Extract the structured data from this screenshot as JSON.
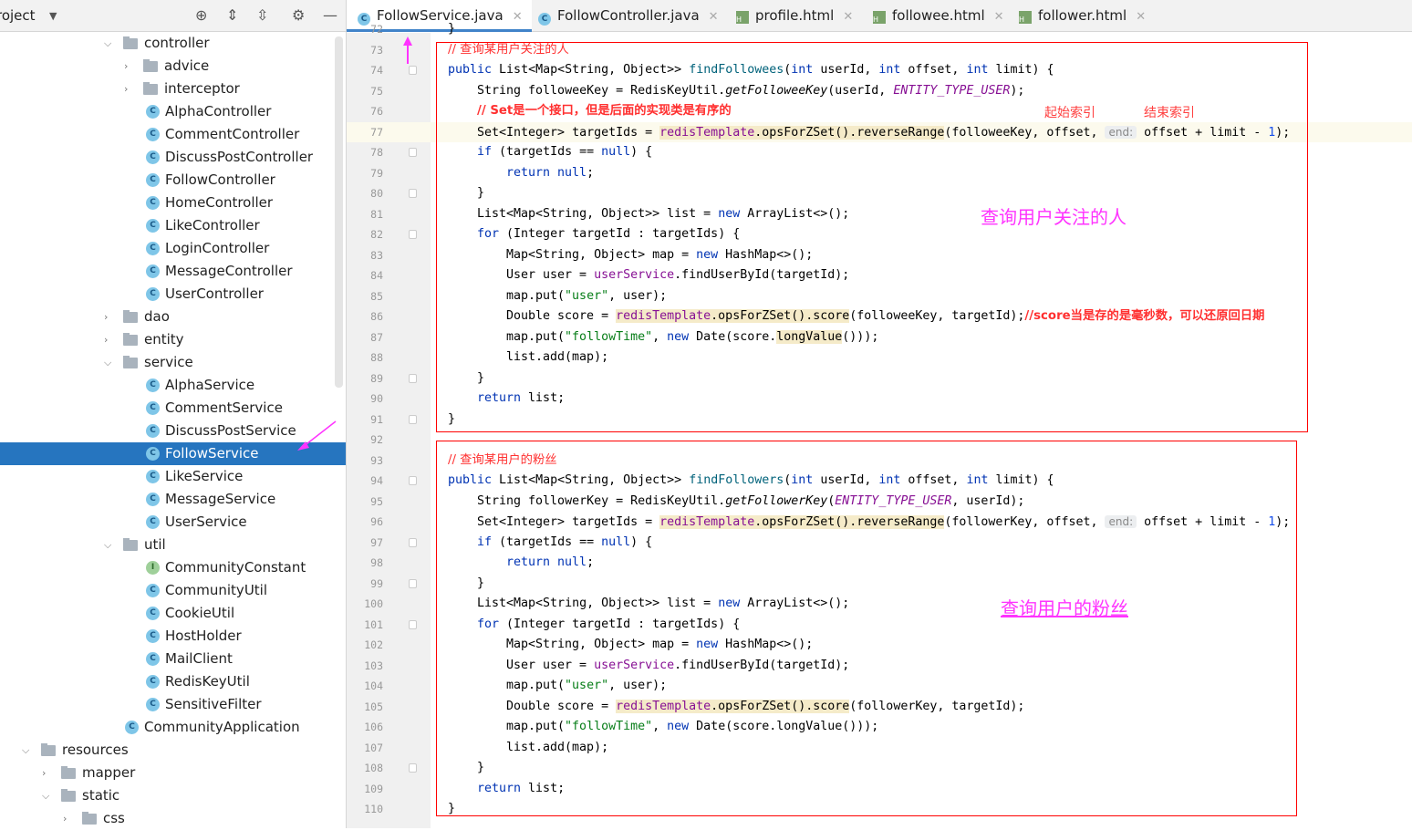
{
  "sidebar": {
    "title": "roject",
    "tree": [
      {
        "label": "controller",
        "type": "folder",
        "depth": 1,
        "expanded": true
      },
      {
        "label": "advice",
        "type": "folder",
        "depth": 2,
        "expanded": false
      },
      {
        "label": "interceptor",
        "type": "folder",
        "depth": 2,
        "expanded": false
      },
      {
        "label": "AlphaController",
        "type": "class",
        "depth": 2
      },
      {
        "label": "CommentController",
        "type": "class",
        "depth": 2
      },
      {
        "label": "DiscussPostController",
        "type": "class",
        "depth": 2
      },
      {
        "label": "FollowController",
        "type": "class",
        "depth": 2
      },
      {
        "label": "HomeController",
        "type": "class",
        "depth": 2
      },
      {
        "label": "LikeController",
        "type": "class",
        "depth": 2
      },
      {
        "label": "LoginController",
        "type": "class",
        "depth": 2
      },
      {
        "label": "MessageController",
        "type": "class",
        "depth": 2
      },
      {
        "label": "UserController",
        "type": "class",
        "depth": 2
      },
      {
        "label": "dao",
        "type": "folder",
        "depth": 1,
        "expanded": false
      },
      {
        "label": "entity",
        "type": "folder",
        "depth": 1,
        "expanded": false
      },
      {
        "label": "service",
        "type": "folder",
        "depth": 1,
        "expanded": true
      },
      {
        "label": "AlphaService",
        "type": "class",
        "depth": 2
      },
      {
        "label": "CommentService",
        "type": "class",
        "depth": 2
      },
      {
        "label": "DiscussPostService",
        "type": "class",
        "depth": 2
      },
      {
        "label": "FollowService",
        "type": "class",
        "depth": 2,
        "selected": true
      },
      {
        "label": "LikeService",
        "type": "class",
        "depth": 2
      },
      {
        "label": "MessageService",
        "type": "class",
        "depth": 2
      },
      {
        "label": "UserService",
        "type": "class",
        "depth": 2
      },
      {
        "label": "util",
        "type": "folder",
        "depth": 1,
        "expanded": true
      },
      {
        "label": "CommunityConstant",
        "type": "interface",
        "depth": 2
      },
      {
        "label": "CommunityUtil",
        "type": "class",
        "depth": 2
      },
      {
        "label": "CookieUtil",
        "type": "class",
        "depth": 2
      },
      {
        "label": "HostHolder",
        "type": "class",
        "depth": 2
      },
      {
        "label": "MailClient",
        "type": "class",
        "depth": 2
      },
      {
        "label": "RedisKeyUtil",
        "type": "class",
        "depth": 2
      },
      {
        "label": "SensitiveFilter",
        "type": "class",
        "depth": 2
      },
      {
        "label": "CommunityApplication",
        "type": "class",
        "depth": 1
      },
      {
        "label": "resources",
        "type": "folder",
        "depth": -2,
        "expanded": true
      },
      {
        "label": "mapper",
        "type": "folder",
        "depth": -1,
        "expanded": false
      },
      {
        "label": "static",
        "type": "folder",
        "depth": -1,
        "expanded": true
      },
      {
        "label": "css",
        "type": "folder",
        "depth": 0,
        "expanded": false
      }
    ]
  },
  "tabs": [
    {
      "label": "FollowService.java",
      "icon": "java-class",
      "active": true
    },
    {
      "label": "FollowController.java",
      "icon": "java-class"
    },
    {
      "label": "profile.html",
      "icon": "html-file"
    },
    {
      "label": "followee.html",
      "icon": "html-file"
    },
    {
      "label": "follower.html",
      "icon": "html-file"
    }
  ],
  "code": [
    {
      "n": "72",
      "seg": [
        [
          "}",
          ""
        ]
      ]
    },
    {
      "n": "73",
      "seg": [
        [
          "// 查询某用户关注的人",
          "c"
        ]
      ]
    },
    {
      "n": "74",
      "fold": true,
      "seg": [
        [
          "public ",
          "k"
        ],
        [
          "List<Map<String, Object>> ",
          ""
        ],
        [
          "findFollowees",
          "d"
        ],
        [
          "(",
          ""
        ],
        [
          "int ",
          "k"
        ],
        [
          "userId, ",
          ""
        ],
        [
          "int ",
          "k"
        ],
        [
          "offset, ",
          ""
        ],
        [
          "int ",
          "k"
        ],
        [
          "limit) {",
          ""
        ]
      ]
    },
    {
      "n": "75",
      "ind": 1,
      "seg": [
        [
          "String followeeKey = RedisKeyUtil.",
          ""
        ],
        [
          "getFolloweeKey",
          "i"
        ],
        [
          "(userId, ",
          ""
        ],
        [
          "ENTITY_TYPE_USER",
          "fi"
        ],
        [
          ");",
          ""
        ]
      ]
    },
    {
      "n": "76",
      "ind": 1,
      "seg": [
        [
          "// Set是一个接口，但是后面的实现类是有序的",
          "cb"
        ]
      ]
    },
    {
      "n": "77",
      "ind": 1,
      "cur": true,
      "seg": [
        [
          "Set<Integer> targetIds = ",
          ""
        ],
        [
          "redisTemplate",
          "f hl"
        ],
        [
          ".opsForZSet().reverseRange",
          "hl"
        ],
        [
          "(followeeKey, offset, ",
          ""
        ],
        [
          "end:",
          "hint"
        ],
        [
          " offset + limit - ",
          ""
        ],
        [
          "1",
          "n"
        ],
        [
          ");",
          ""
        ]
      ]
    },
    {
      "n": "78",
      "ind": 1,
      "fold": true,
      "seg": [
        [
          "if ",
          "k"
        ],
        [
          "(targetIds == ",
          ""
        ],
        [
          "null",
          "k"
        ],
        [
          ") {",
          ""
        ]
      ]
    },
    {
      "n": "79",
      "ind": 2,
      "seg": [
        [
          "return null",
          "k"
        ],
        [
          ";",
          ""
        ]
      ]
    },
    {
      "n": "80",
      "ind": 1,
      "fold": true,
      "seg": [
        [
          "}",
          ""
        ]
      ]
    },
    {
      "n": "81",
      "ind": 1,
      "seg": [
        [
          "List<Map<String, Object>> list = ",
          ""
        ],
        [
          "new ",
          "k"
        ],
        [
          "ArrayList<>();",
          ""
        ]
      ]
    },
    {
      "n": "82",
      "ind": 1,
      "fold": true,
      "seg": [
        [
          "for ",
          "k"
        ],
        [
          "(Integer targetId : targetIds) {",
          ""
        ]
      ]
    },
    {
      "n": "83",
      "ind": 2,
      "seg": [
        [
          "Map<String, Object> map = ",
          ""
        ],
        [
          "new ",
          "k"
        ],
        [
          "HashMap<>();",
          ""
        ]
      ]
    },
    {
      "n": "84",
      "ind": 2,
      "seg": [
        [
          "User user = ",
          ""
        ],
        [
          "userService",
          "f"
        ],
        [
          ".findUserById(targetId);",
          ""
        ]
      ]
    },
    {
      "n": "85",
      "ind": 2,
      "seg": [
        [
          "map.put(",
          ""
        ],
        [
          "\"user\"",
          "s"
        ],
        [
          ", user);",
          ""
        ]
      ]
    },
    {
      "n": "86",
      "ind": 2,
      "seg": [
        [
          "Double score = ",
          ""
        ],
        [
          "redisTemplate",
          "f hl"
        ],
        [
          ".opsForZSet().score",
          "hl"
        ],
        [
          "(followeeKey, targetId);",
          ""
        ],
        [
          "//score当是存的是毫秒数，可以还原回日期",
          "cb"
        ]
      ]
    },
    {
      "n": "87",
      "ind": 2,
      "seg": [
        [
          "map.put(",
          ""
        ],
        [
          "\"followTime\"",
          "s"
        ],
        [
          ", ",
          ""
        ],
        [
          "new ",
          "k"
        ],
        [
          "Date(score.",
          ""
        ],
        [
          "longValue",
          "hl"
        ],
        [
          "()));",
          ""
        ]
      ]
    },
    {
      "n": "88",
      "ind": 2,
      "seg": [
        [
          "list.add(map);",
          ""
        ]
      ]
    },
    {
      "n": "89",
      "ind": 1,
      "fold": true,
      "seg": [
        [
          "}",
          ""
        ]
      ]
    },
    {
      "n": "90",
      "ind": 1,
      "seg": [
        [
          "return ",
          "k"
        ],
        [
          "list;",
          ""
        ]
      ]
    },
    {
      "n": "91",
      "fold": true,
      "seg": [
        [
          "}",
          ""
        ]
      ]
    },
    {
      "n": "92",
      "seg": []
    },
    {
      "n": "93",
      "seg": [
        [
          "// 查询某用户的粉丝",
          "c"
        ]
      ]
    },
    {
      "n": "94",
      "fold": true,
      "seg": [
        [
          "public ",
          "k"
        ],
        [
          "List<Map<String, Object>> ",
          ""
        ],
        [
          "findFollowers",
          "d"
        ],
        [
          "(",
          ""
        ],
        [
          "int ",
          "k"
        ],
        [
          "userId, ",
          ""
        ],
        [
          "int ",
          "k"
        ],
        [
          "offset, ",
          ""
        ],
        [
          "int ",
          "k"
        ],
        [
          "limit) {",
          ""
        ]
      ]
    },
    {
      "n": "95",
      "ind": 1,
      "seg": [
        [
          "String followerKey = RedisKeyUtil.",
          ""
        ],
        [
          "getFollowerKey",
          "i"
        ],
        [
          "(",
          ""
        ],
        [
          "ENTITY_TYPE_USER",
          "fi"
        ],
        [
          ", userId);",
          ""
        ]
      ]
    },
    {
      "n": "96",
      "ind": 1,
      "seg": [
        [
          "Set<Integer> targetIds = ",
          ""
        ],
        [
          "redisTemplate",
          "f hl"
        ],
        [
          ".opsForZSet().reverseRange",
          "hl"
        ],
        [
          "(followerKey, offset, ",
          ""
        ],
        [
          "end:",
          "hint"
        ],
        [
          " offset + limit - ",
          ""
        ],
        [
          "1",
          "n"
        ],
        [
          ");",
          ""
        ]
      ]
    },
    {
      "n": "97",
      "ind": 1,
      "fold": true,
      "seg": [
        [
          "if ",
          "k"
        ],
        [
          "(targetIds == ",
          ""
        ],
        [
          "null",
          "k"
        ],
        [
          ") {",
          ""
        ]
      ]
    },
    {
      "n": "98",
      "ind": 2,
      "seg": [
        [
          "return null",
          "k"
        ],
        [
          ";",
          ""
        ]
      ]
    },
    {
      "n": "99",
      "ind": 1,
      "fold": true,
      "seg": [
        [
          "}",
          ""
        ]
      ]
    },
    {
      "n": "100",
      "ind": 1,
      "seg": [
        [
          "List<Map<String, Object>> list = ",
          ""
        ],
        [
          "new ",
          "k"
        ],
        [
          "ArrayList<>();",
          ""
        ]
      ]
    },
    {
      "n": "101",
      "ind": 1,
      "fold": true,
      "seg": [
        [
          "for ",
          "k"
        ],
        [
          "(Integer targetId : targetIds) {",
          ""
        ]
      ]
    },
    {
      "n": "102",
      "ind": 2,
      "seg": [
        [
          "Map<String, Object> map = ",
          ""
        ],
        [
          "new ",
          "k"
        ],
        [
          "HashMap<>();",
          ""
        ]
      ]
    },
    {
      "n": "103",
      "ind": 2,
      "seg": [
        [
          "User user = ",
          ""
        ],
        [
          "userService",
          "f"
        ],
        [
          ".findUserById(targetId);",
          ""
        ]
      ]
    },
    {
      "n": "104",
      "ind": 2,
      "seg": [
        [
          "map.put(",
          ""
        ],
        [
          "\"user\"",
          "s"
        ],
        [
          ", user);",
          ""
        ]
      ]
    },
    {
      "n": "105",
      "ind": 2,
      "seg": [
        [
          "Double score = ",
          ""
        ],
        [
          "redisTemplate",
          "f hl"
        ],
        [
          ".opsForZSet().score",
          "hl"
        ],
        [
          "(followerKey, targetId);",
          ""
        ]
      ]
    },
    {
      "n": "106",
      "ind": 2,
      "seg": [
        [
          "map.put(",
          ""
        ],
        [
          "\"followTime\"",
          "s"
        ],
        [
          ", ",
          ""
        ],
        [
          "new ",
          "k"
        ],
        [
          "Date(score.longValue()));",
          ""
        ]
      ]
    },
    {
      "n": "107",
      "ind": 2,
      "seg": [
        [
          "list.add(map);",
          ""
        ]
      ]
    },
    {
      "n": "108",
      "ind": 1,
      "fold": true,
      "seg": [
        [
          "}",
          ""
        ]
      ]
    },
    {
      "n": "109",
      "ind": 1,
      "seg": [
        [
          "return ",
          "k"
        ],
        [
          "list;",
          ""
        ]
      ]
    },
    {
      "n": "110",
      "seg": [
        [
          "}",
          ""
        ]
      ]
    }
  ],
  "annotations": {
    "start_index": "起始索引",
    "end_index": "结束索引",
    "followees_note": "查询用户关注的人",
    "followers_note": "查询用户的粉丝"
  },
  "colors": {
    "selection": "#2675bf",
    "annotation_box": "#ff0000",
    "arrow": "#ff33ff",
    "comment": "#ff3030"
  }
}
